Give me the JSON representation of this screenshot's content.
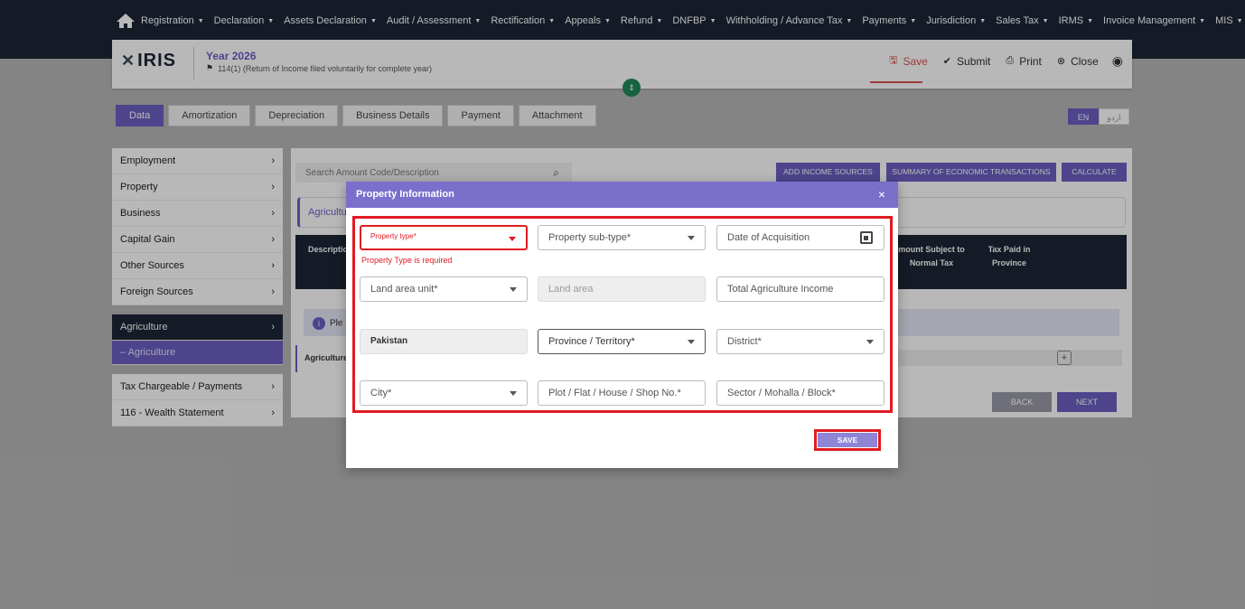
{
  "topnav": {
    "items": [
      "Registration",
      "Declaration",
      "Assets Declaration",
      "Audit / Assessment",
      "Rectification",
      "Appeals",
      "Refund",
      "DNFBP",
      "Withholding / Advance Tax",
      "Payments",
      "Jurisdiction",
      "Sales Tax",
      "IRMS",
      "Invoice Management",
      "MIS"
    ]
  },
  "header": {
    "logo": "IRIS",
    "year": "Year 2026",
    "subtitle": "114(1) (Return of Income filed voluntarily for complete year)",
    "actions": {
      "save": "Save",
      "submit": "Submit",
      "print": "Print",
      "close": "Close"
    }
  },
  "tabs": [
    "Data",
    "Amortization",
    "Depreciation",
    "Business Details",
    "Payment",
    "Attachment"
  ],
  "lang": {
    "en": "EN",
    "ur": "اردو"
  },
  "sidebar": {
    "items": [
      "Employment",
      "Property",
      "Business",
      "Capital Gain",
      "Other Sources",
      "Foreign Sources"
    ],
    "active_section": "Agriculture",
    "active_sub": "– Agriculture",
    "bottom_items": [
      "Tax Chargeable / Payments",
      "116 - Wealth Statement"
    ]
  },
  "content": {
    "search_placeholder": "Search Amount Code/Description",
    "buttons": {
      "add_income": "ADD INCOME SOURCES",
      "summary": "SUMMARY OF ECONOMIC TRANSACTIONS",
      "calculate": "CALCULATE"
    },
    "section_title": "Agricultu",
    "table_headers": {
      "description": "Descriptio",
      "amount_subject": "mount Subject to\nNormal Tax",
      "tax_paid": "Tax Paid in\nProvince"
    },
    "info_text": "Ple",
    "agri_row_label": "Agriculture",
    "back": "BACK",
    "next": "NEXT"
  },
  "modal": {
    "title": "Property Information",
    "close": "×",
    "fields": {
      "property_type": "Property type*",
      "property_subtype": "Property sub-type*",
      "date_acquisition": "Date of Acquisition",
      "land_area_unit": "Land area unit*",
      "land_area": "Land area",
      "total_agri_income": "Total Agriculture Income",
      "country": "Pakistan",
      "province": "Province / Territory*",
      "district": "District*",
      "city": "City*",
      "plot": "Plot / Flat / House / Shop No.*",
      "sector": "Sector / Mohalla / Block*"
    },
    "error": "Property Type is required",
    "save": "SAVE"
  },
  "colors": {
    "accent": "#6b5fc2",
    "nav": "#1c2635",
    "error": "#e11a22",
    "header": "#7b6fcc"
  }
}
